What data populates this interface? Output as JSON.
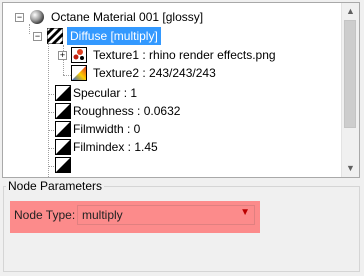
{
  "tree": {
    "root": {
      "label": "Octane Material 001  [glossy]",
      "icon": "sphere-icon"
    },
    "diffuse": {
      "label": "Diffuse  [multiply]",
      "icon": "checker-icon"
    },
    "texture1": {
      "label": "Texture1 : rhino render effects.png",
      "icon": "image-texture-icon"
    },
    "texture2": {
      "label": "Texture2 : 243/243/243",
      "icon": "color-texture-icon"
    },
    "items": [
      {
        "label": "Specular : 1",
        "icon": "float-ramp-icon"
      },
      {
        "label": "Roughness : 0.0632",
        "icon": "float-ramp-icon"
      },
      {
        "label": "Filmwidth : 0",
        "icon": "float-ramp-icon"
      },
      {
        "label": "Filmindex : 1.45",
        "icon": "float-ramp-icon"
      }
    ]
  },
  "node_params": {
    "title": "Node Parameters",
    "node_type_label": "Node Type:",
    "node_type_value": "multiply"
  },
  "colors": {
    "selection": "#3399ff",
    "highlight": "#ff6e6e"
  }
}
